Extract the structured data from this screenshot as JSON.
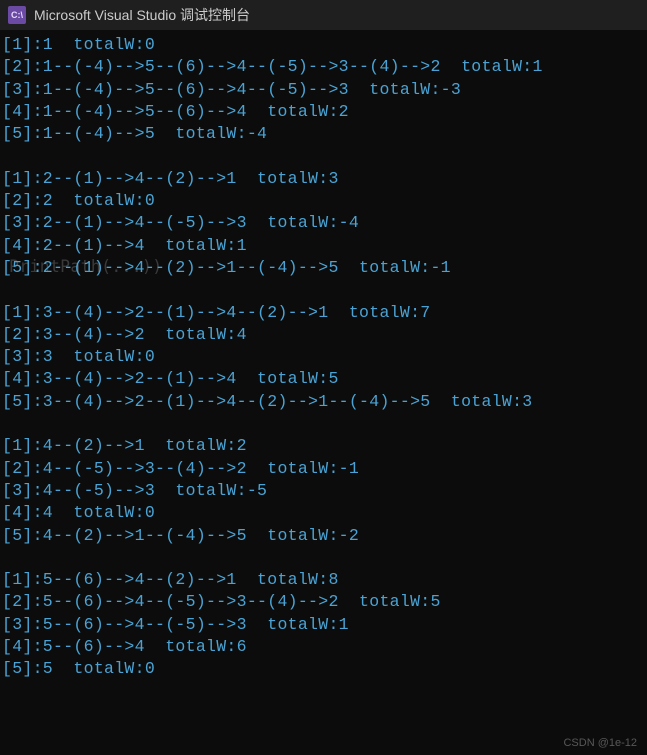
{
  "titlebar": {
    "icon_label": "C:\\",
    "title": "Microsoft Visual Studio 调试控制台"
  },
  "ghost_text": "   PrintPath(...))",
  "watermark": "CSDN @1e-12",
  "output_blocks": [
    [
      "[1]:1  totalW:0",
      "[2]:1--(-4)-->5--(6)-->4--(-5)-->3--(4)-->2  totalW:1",
      "[3]:1--(-4)-->5--(6)-->4--(-5)-->3  totalW:-3",
      "[4]:1--(-4)-->5--(6)-->4  totalW:2",
      "[5]:1--(-4)-->5  totalW:-4"
    ],
    [
      "[1]:2--(1)-->4--(2)-->1  totalW:3",
      "[2]:2  totalW:0",
      "[3]:2--(1)-->4--(-5)-->3  totalW:-4",
      "[4]:2--(1)-->4  totalW:1",
      "[5]:2--(1)-->4--(2)-->1--(-4)-->5  totalW:-1"
    ],
    [
      "[1]:3--(4)-->2--(1)-->4--(2)-->1  totalW:7",
      "[2]:3--(4)-->2  totalW:4",
      "[3]:3  totalW:0",
      "[4]:3--(4)-->2--(1)-->4  totalW:5",
      "[5]:3--(4)-->2--(1)-->4--(2)-->1--(-4)-->5  totalW:3"
    ],
    [
      "[1]:4--(2)-->1  totalW:2",
      "[2]:4--(-5)-->3--(4)-->2  totalW:-1",
      "[3]:4--(-5)-->3  totalW:-5",
      "[4]:4  totalW:0",
      "[5]:4--(2)-->1--(-4)-->5  totalW:-2"
    ],
    [
      "[1]:5--(6)-->4--(2)-->1  totalW:8",
      "[2]:5--(6)-->4--(-5)-->3--(4)-->2  totalW:5",
      "[3]:5--(6)-->4--(-5)-->3  totalW:1",
      "[4]:5--(6)-->4  totalW:6",
      "[5]:5  totalW:0"
    ]
  ]
}
